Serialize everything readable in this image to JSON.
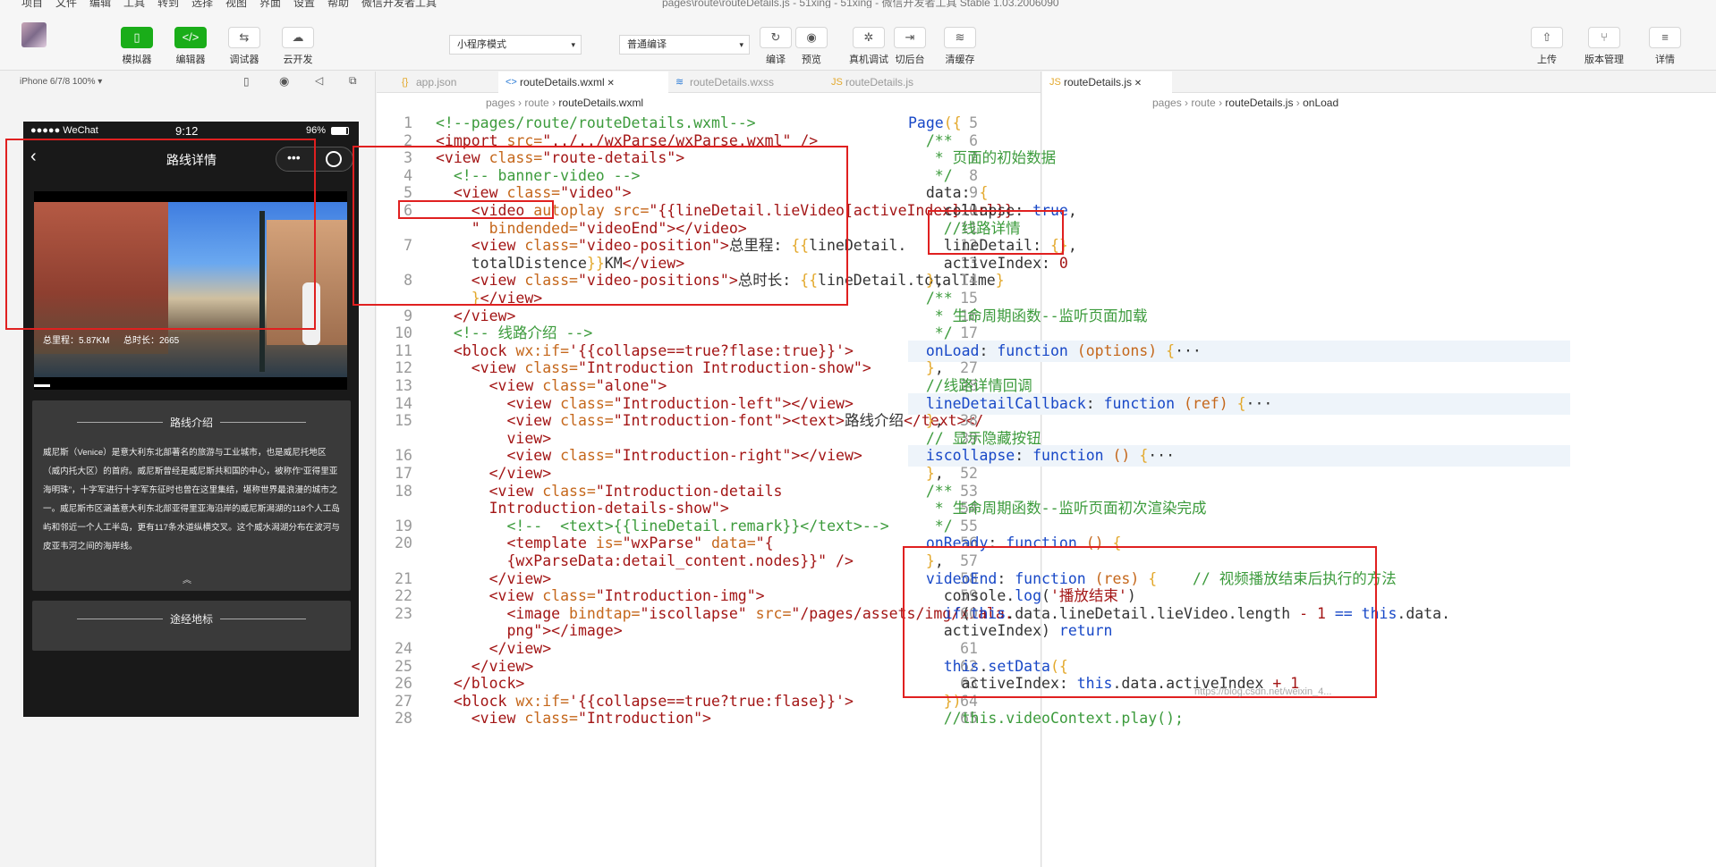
{
  "menubar": {
    "items": [
      "项目",
      "文件",
      "编辑",
      "工具",
      "转到",
      "选择",
      "视图",
      "界面",
      "设置",
      "帮助",
      "微信开发者工具"
    ],
    "title": "pages\\route\\routeDetails.js - 51xing - 51xing - 微信开发者工具 Stable 1.03.2006090"
  },
  "toolbar": {
    "left": [
      {
        "label": "模拟器",
        "icon": "phone-icon",
        "glyph": "▯"
      },
      {
        "label": "编辑器",
        "icon": "code-icon",
        "glyph": "</>"
      },
      {
        "label": "调试器",
        "icon": "debug-icon",
        "glyph": "⇆"
      },
      {
        "label": "云开发",
        "icon": "cloud-icon",
        "glyph": "☁"
      }
    ],
    "mode_select": "小程序模式",
    "compile_select": "普通编译",
    "mid": [
      {
        "label": "编译",
        "icon": "refresh-icon",
        "glyph": "↻"
      },
      {
        "label": "预览",
        "icon": "eye-icon",
        "glyph": "◉"
      },
      {
        "label": "真机调试",
        "icon": "bug-icon",
        "glyph": "✲"
      },
      {
        "label": "切后台",
        "icon": "switch-icon",
        "glyph": "⇥"
      },
      {
        "label": "清缓存",
        "icon": "layers-icon",
        "glyph": "≋"
      }
    ],
    "right": [
      {
        "label": "上传",
        "icon": "upload-icon",
        "glyph": "⇧"
      },
      {
        "label": "版本管理",
        "icon": "branch-icon",
        "glyph": "⑂"
      },
      {
        "label": "详情",
        "icon": "menu-icon",
        "glyph": "≡"
      }
    ]
  },
  "simulator": {
    "device": "iPhone 6/7/8 100% ▾",
    "status_carrier": "●●●●● WeChat",
    "status_time": "9:12",
    "status_battery": "96%",
    "nav_title": "路线详情",
    "video_distance": "总里程：5.87KM",
    "video_duration": "总时长：2665",
    "section1_title": "路线介绍",
    "section1_text": "威尼斯（Venice）是意大利东北部著名的旅游与工业城市，也是威尼托地区（威内托大区）的首府。威尼斯曾经是威尼斯共和国的中心，被称作“亚得里亚海明珠”，十字军进行十字军东征时也曾在这里集结，堪称世界最浪漫的城市之一。威尼斯市区涵盖意大利东北部亚得里亚海沿岸的威尼斯潟湖的118个人工岛屿和邻近一个人工半岛，更有117条水道纵横交叉。这个威水潟湖分布在波河与皮亚韦河之间的海岸线。",
    "section2_title": "途经地标"
  },
  "editor1": {
    "tabs": [
      {
        "label": "app.json",
        "icon": "{}",
        "color": "#e3a82b"
      },
      {
        "label": "routeDetails.wxml",
        "icon": "<>",
        "color": "#2b7bd6",
        "active": true
      },
      {
        "label": "routeDetails.wxss",
        "icon": "≋",
        "color": "#2b7bd6"
      },
      {
        "label": "routeDetails.js",
        "icon": "JS",
        "color": "#e3a82b"
      }
    ],
    "breadcrumb": [
      "pages",
      "route",
      "routeDetails.wxml"
    ]
  },
  "editor2": {
    "tabs": [
      {
        "label": "routeDetails.js",
        "icon": "JS",
        "color": "#e3a82b",
        "active": true
      }
    ],
    "breadcrumb": [
      "pages",
      "route",
      "routeDetails.js",
      "onLoad"
    ]
  },
  "watermark": "https://blog.csdn.net/weixin_4..."
}
